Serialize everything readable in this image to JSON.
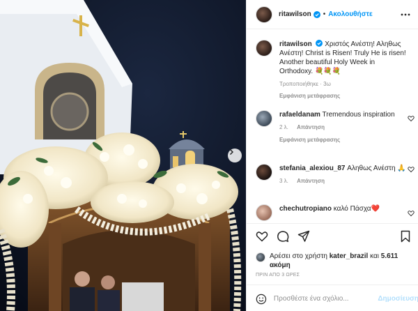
{
  "post": {
    "author": "ritawilson",
    "follow_label": "Ακολουθήστε",
    "verified": true
  },
  "caption": {
    "author": "ritawilson",
    "text": "Χριστός Ανέστη! Αληθως Ανέστη! Christ is Risen! Truly He is risen! Another beautiful Holy Week in Orthodoxy.",
    "emojis": "💐💐💐",
    "translated_note": "Τροποποιήθηκε · 3ω",
    "see_translation": "Εμφάνιση μετάφρασης"
  },
  "comments": [
    {
      "user": "rafaeldanam",
      "text": "Tremendous inspiration",
      "time": "2 λ.",
      "reply": "Απάντηση",
      "see_translation": "Εμφάνιση μετάφρασης"
    },
    {
      "user": "stefania_alexiou_87",
      "text": "Αληθως Ανέστη 🙏",
      "time": "3 λ.",
      "reply": "Απάντηση"
    },
    {
      "user": "chechutropiano",
      "text": "καλό Πάσχα❤️",
      "time": "",
      "reply": ""
    }
  ],
  "likes": {
    "prefix": "Αρέσει στο χρήστη ",
    "user": "kater_brazil",
    "middle": " και ",
    "count": "5.611",
    "suffix": "ακόμη"
  },
  "posted_ago": "ΠΡΙΝ ΑΠΟ 3 ΩΡΕΣ",
  "add_comment": {
    "placeholder": "Προσθέστε ένα σχόλιο...",
    "publish_label": "Δημοσίευση"
  },
  "icons": [
    "more-icon",
    "heart-icon",
    "comment-icon",
    "share-icon",
    "bookmark-icon",
    "emoji-icon",
    "next-arrow-icon",
    "verified-icon"
  ],
  "colors": {
    "accent": "#0095f6",
    "publish_disabled": "#b2dffc",
    "muted": "#8e8e8e",
    "heart_red": "#ed4956"
  }
}
